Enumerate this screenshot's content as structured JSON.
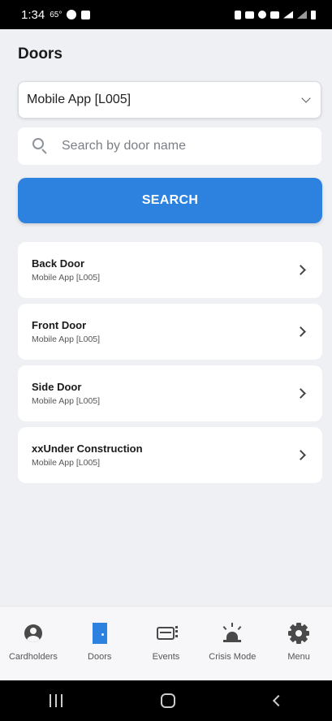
{
  "status_bar": {
    "time": "1:34",
    "temp": "65°"
  },
  "header": {
    "title": "Doors"
  },
  "location_select": {
    "value": "Mobile App [L005]"
  },
  "search": {
    "placeholder": "Search by door name",
    "button_label": "SEARCH"
  },
  "doors": [
    {
      "name": "Back Door",
      "location": "Mobile App [L005]"
    },
    {
      "name": "Front Door",
      "location": "Mobile App [L005]"
    },
    {
      "name": "Side Door",
      "location": "Mobile App [L005]"
    },
    {
      "name": "xxUnder Construction",
      "location": "Mobile App [L005]"
    }
  ],
  "bottom_nav": [
    {
      "label": "Cardholders",
      "icon": "user-circle-icon"
    },
    {
      "label": "Doors",
      "icon": "door-icon",
      "active": true
    },
    {
      "label": "Events",
      "icon": "events-icon"
    },
    {
      "label": "Crisis Mode",
      "icon": "siren-icon"
    },
    {
      "label": "Menu",
      "icon": "gear-icon"
    }
  ],
  "colors": {
    "accent": "#2c82de",
    "background": "#eef0f3",
    "card": "#ffffff"
  }
}
